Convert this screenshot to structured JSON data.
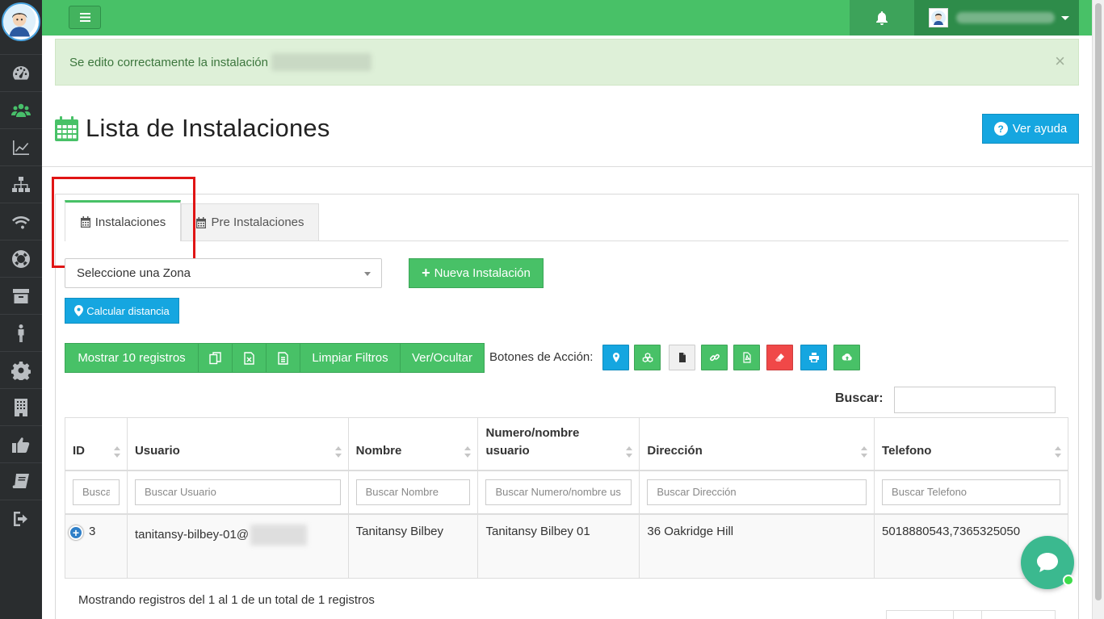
{
  "sidebar": {
    "items": [
      {
        "icon": "dashboard-icon"
      },
      {
        "icon": "users-icon",
        "active": true
      },
      {
        "icon": "chart-line-icon"
      },
      {
        "icon": "sitemap-icon"
      },
      {
        "icon": "wifi-icon"
      },
      {
        "icon": "life-ring-icon"
      },
      {
        "icon": "archive-icon"
      },
      {
        "icon": "person-icon"
      },
      {
        "icon": "gear-icon"
      },
      {
        "icon": "building-icon"
      },
      {
        "icon": "thumbs-up-icon"
      },
      {
        "icon": "book-icon"
      },
      {
        "icon": "sign-out-icon"
      }
    ]
  },
  "alert": {
    "message": "Se edito correctamente la instalación",
    "close": "×"
  },
  "header": {
    "title": "Lista de Instalaciones",
    "help_label": "Ver ayuda"
  },
  "tabs": [
    {
      "label": "Instalaciones",
      "active": true
    },
    {
      "label": "Pre Instalaciones",
      "active": false
    }
  ],
  "controls": {
    "zone_select": "Seleccione una Zona",
    "new_button": "Nueva Instalación",
    "calc_button": "Calcular distancia"
  },
  "toolbar": {
    "show_records": "Mostrar 10 registros",
    "clear_filters": "Limpiar Filtros",
    "toggle": "Ver/Ocultar",
    "actions_label": "Botones de Acción:"
  },
  "action_colors": {
    "blue": "#15a6e0",
    "green": "#48c167",
    "light": "#f0f0f0",
    "red": "#f04848"
  },
  "search": {
    "label": "Buscar:"
  },
  "table": {
    "columns": [
      "ID",
      "Usuario",
      "Nombre",
      "Numero/nombre usuario",
      "Dirección",
      "Telefono"
    ],
    "filters": [
      "Busca",
      "Buscar Usuario",
      "Buscar Nombre",
      "Buscar Numero/nombre us",
      "Buscar Dirección",
      "Buscar Telefono"
    ],
    "rows": [
      {
        "id": "3",
        "usuario": "tanitansy-bilbey-01@",
        "nombre": "Tanitansy Bilbey",
        "numero": "Tanitansy Bilbey 01",
        "direccion": "36 Oakridge Hill",
        "telefono": "5018880543,7365325050"
      }
    ]
  },
  "footer": {
    "info": "Mostrando registros del 1 al 1 de un total de 1 registros"
  }
}
